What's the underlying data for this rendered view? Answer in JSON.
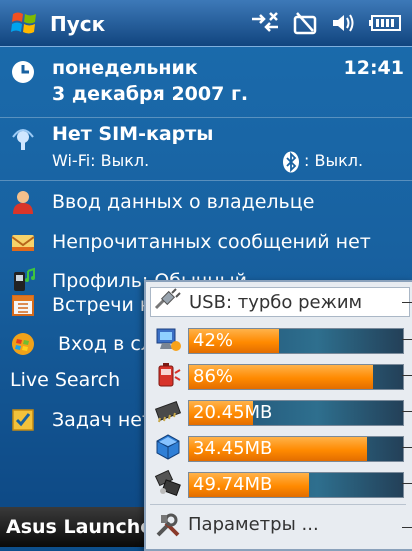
{
  "statusbar": {
    "title": "Пуск"
  },
  "today": {
    "date": {
      "day": "понедельник",
      "full_date": "3 декабря 2007 г.",
      "time": "12:41"
    },
    "sim": {
      "title": "Нет SIM-карты",
      "wifi": "Wi-Fi: Выкл.",
      "bluetooth": ": Выкл."
    },
    "items": [
      {
        "label": "Ввод данных о владельце",
        "icon": "owner-icon"
      },
      {
        "label": "Непрочитанных сообщений нет",
        "icon": "messages-icon"
      },
      {
        "label": "Профиль: Обычный",
        "icon": "profile-icon"
      },
      {
        "label": "Встречи н",
        "icon": "calendar-icon"
      },
      {
        "label": "Вход в сл",
        "icon": "windows-live-icon"
      },
      {
        "label": "Live Search",
        "icon": ""
      },
      {
        "label": "Задач нет",
        "icon": "tasks-icon"
      }
    ]
  },
  "bottombar": {
    "label": "Asus Launche"
  },
  "launcher": {
    "usb": {
      "label": "USB: турбо режим",
      "icon": "usb-plug-icon"
    },
    "meters": [
      {
        "name": "cpu",
        "label": "42%",
        "fill": 0.42,
        "icon": "cpu-icon"
      },
      {
        "name": "battery",
        "label": "86%",
        "fill": 0.86,
        "icon": "battery-icon"
      },
      {
        "name": "memory",
        "label": "20.45MB",
        "fill": 0.3,
        "icon": "memory-chip-icon"
      },
      {
        "name": "storage",
        "label": "34.45MB",
        "fill": 0.83,
        "icon": "storage-disk-icon"
      },
      {
        "name": "sdcard",
        "label": "49.74MB",
        "fill": 0.56,
        "icon": "sd-card-icon"
      }
    ],
    "settings": {
      "label": "Параметры ...",
      "icon": "settings-tools-icon"
    }
  },
  "colors": {
    "background": "#1861a0",
    "bar_fill": "#ff8a00",
    "bar_track": "#234058"
  }
}
